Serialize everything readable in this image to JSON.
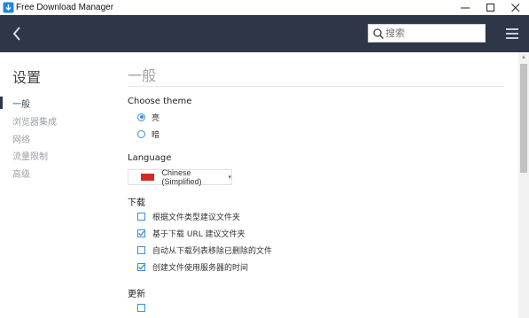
{
  "window": {
    "title": "Free Download Manager",
    "minimize": "—",
    "maximize": "☐",
    "close": "✕"
  },
  "toolbar": {
    "back_icon": "back-arrow-icon",
    "search_placeholder": "搜索",
    "menu_icon": "hamburger-menu-icon"
  },
  "sidebar": {
    "title": "设置",
    "items": [
      {
        "label": "一般",
        "active": true
      },
      {
        "label": "浏览器集成",
        "active": false
      },
      {
        "label": "网络",
        "active": false
      },
      {
        "label": "流量限制",
        "active": false
      },
      {
        "label": "高级",
        "active": false
      }
    ]
  },
  "main": {
    "title": "一般",
    "theme": {
      "heading": "Choose theme",
      "options": [
        {
          "label": "亮",
          "checked": true
        },
        {
          "label": "暗",
          "checked": false
        }
      ]
    },
    "language": {
      "heading": "Language",
      "selected": "Chinese (Simplified)"
    },
    "download": {
      "heading": "下载",
      "options": [
        {
          "label": "根据文件类型建议文件夹",
          "checked": false
        },
        {
          "label": "基于下载 URL 建议文件夹",
          "checked": true
        },
        {
          "label": "自动从下载列表移除已删除的文件",
          "checked": false
        },
        {
          "label": "创建文件使用服务器的时间",
          "checked": true
        }
      ]
    },
    "update": {
      "heading": "更新"
    }
  },
  "colors": {
    "toolbar_bg": "#2e3748",
    "accent": "#3c8fd9",
    "flag_red": "#d62a20"
  }
}
